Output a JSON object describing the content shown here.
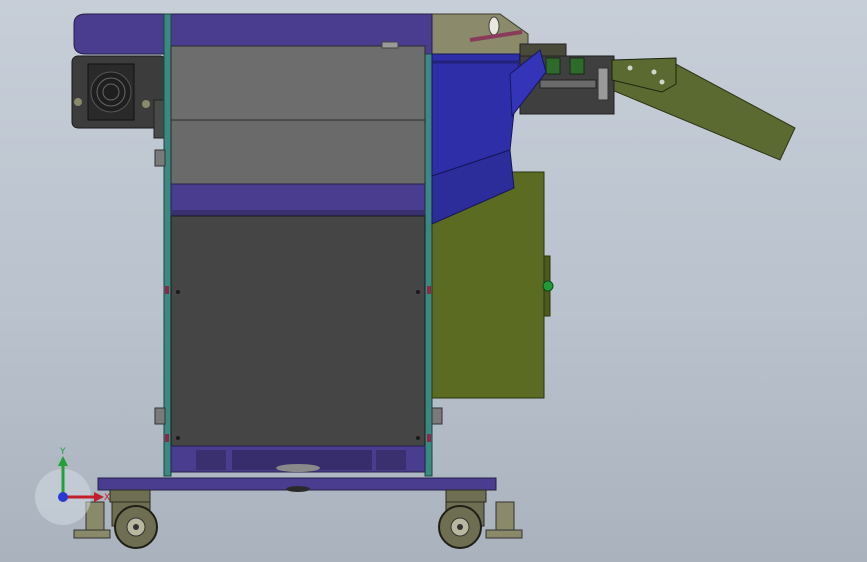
{
  "viewport": {
    "background_top": "#c7ced8",
    "background_bottom": "#a9b2bd"
  },
  "triad": {
    "x_label": "X",
    "y_label": "Y",
    "x_color": "#c0202a",
    "y_color": "#22a03a",
    "z_color": "#2a3ad0"
  },
  "model": {
    "colors": {
      "purple": "#4a3d8f",
      "dark_panel": "#454545",
      "grey_panel": "#6d6d6d",
      "blue_hopper": "#2e2fa8",
      "olive_box": "#5c6b22",
      "olive_chute": "#5a6a30",
      "frame_teal": "#3a8a82",
      "caster": "#6e6e52"
    }
  }
}
